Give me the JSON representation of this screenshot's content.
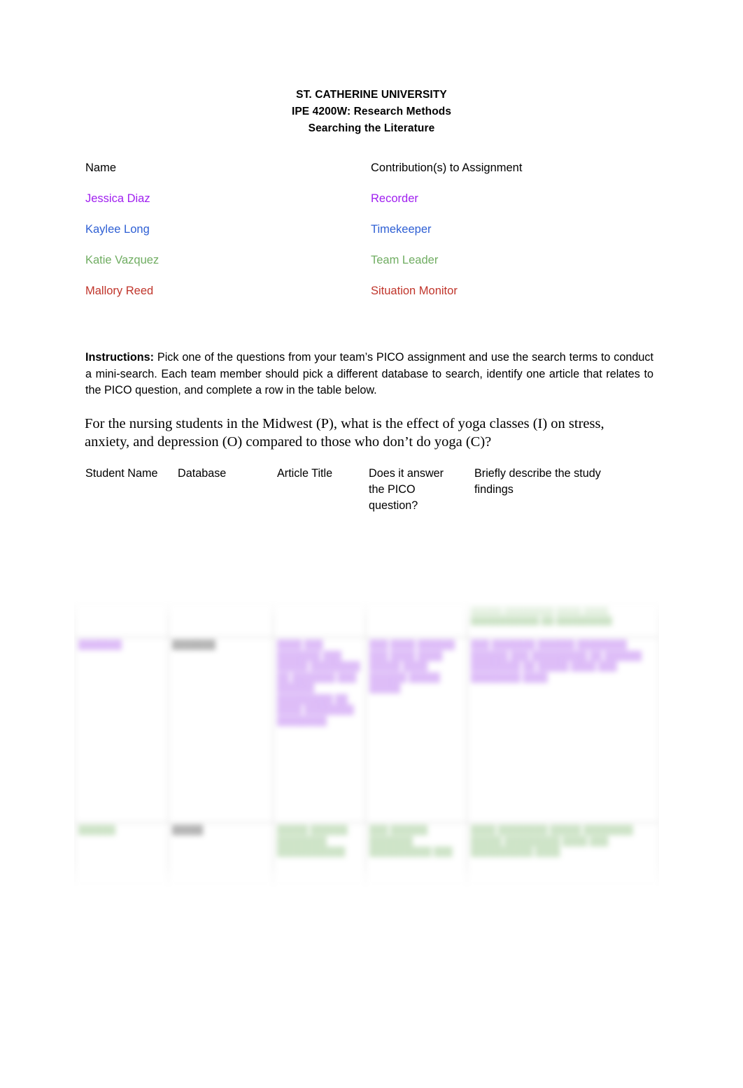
{
  "document": {
    "heading": {
      "line1": "ST. CATHERINE UNIVERSITY",
      "line2": "IPE 4200W: Research Methods",
      "line3": "Searching the Literature"
    },
    "roles_table": {
      "header": {
        "name": "Name",
        "contribution": "Contribution(s) to Assignment"
      },
      "rows": [
        {
          "name": "Jessica Diaz",
          "contribution": "Recorder",
          "color": "#A020F0"
        },
        {
          "name": "Kaylee Long",
          "contribution": "Timekeeper",
          "color": "#2E5FD4"
        },
        {
          "name": "Katie Vazquez",
          "contribution": "Team Leader",
          "color": "#70AD62"
        },
        {
          "name": "Mallory Reed",
          "contribution": "Situation Monitor",
          "color": "#C0352B"
        }
      ]
    },
    "instructions": {
      "label": "Instructions:",
      "body": " Pick one of the questions from your team’s PICO assignment and use the search terms to conduct a mini-search. Each team member should pick a different database to search, identify one article that relates to the PICO question, and complete a row in the table below."
    },
    "pico_question": "For the nursing students in the Midwest (P), what is the effect of yoga classes (I) on stress, anxiety, and depression (O) compared to those who don’t do yoga (C)?",
    "results_table": {
      "columns": [
        "Student Name",
        "Database",
        "Article Title",
        "Does it answer the PICO question?",
        "Briefly describe the study findings"
      ],
      "blurred_rows": [
        {
          "student_name": "",
          "database": "",
          "article_title": "",
          "answers_pico": "",
          "findings": "█████ ████████ ████ ████ ███████████ ██ █████████"
        },
        {
          "student_name": "███████",
          "database": "███████",
          "article_title": "████ ███ ███████ ███ █████ ████████ ██ ███████ ███ ██████ █████████ ██ ████ ████████ ████████",
          "answers_pico": "███ ████ ██████ ███ ████ ████ █████ ████ ██████ █████ █████",
          "findings": "███ ███████ ██████ ████████ ██████ ███ █████████ ██ ██████ ████████ ██ █████ ████ ███ ████████ ████"
        },
        {
          "student_name": "██████",
          "database": "█████",
          "article_title": "█████ ██████ ████████ ███████████",
          "answers_pico": "███ ██████ ███████ ██████████ ███",
          "findings": "████ ████████ █████ ████████ █████ █████████ ████ ███ ██████████ ████"
        }
      ]
    }
  }
}
